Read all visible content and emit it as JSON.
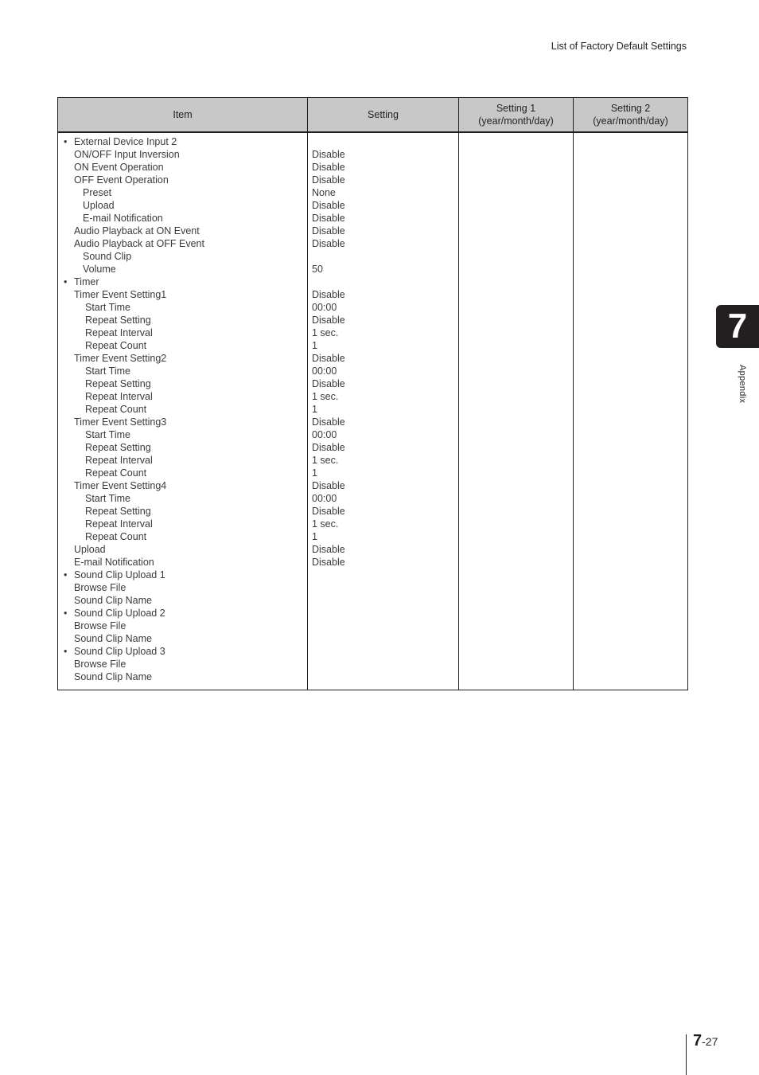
{
  "header": {
    "running_title": "List of Factory Default Settings"
  },
  "table": {
    "columns": [
      "Item",
      "Setting",
      "Setting 1\n(year/month/day)",
      "Setting 2\n(year/month/day)"
    ],
    "column_lines": {
      "item": "Item",
      "setting": "Setting",
      "setting1": [
        "Setting 1",
        "(year/month/day)"
      ],
      "setting2": [
        "Setting 2",
        "(year/month/day)"
      ]
    },
    "rows": [
      {
        "item": "External Device Input 2",
        "level": 0,
        "bullet": true,
        "value": ""
      },
      {
        "item": "ON/OFF Input Inversion",
        "level": 0,
        "bullet": false,
        "value": "Disable"
      },
      {
        "item": "ON Event Operation",
        "level": 0,
        "bullet": false,
        "value": "Disable"
      },
      {
        "item": "OFF Event Operation",
        "level": 0,
        "bullet": false,
        "value": "Disable"
      },
      {
        "item": "Preset",
        "level": 1,
        "bullet": false,
        "value": "None"
      },
      {
        "item": "Upload",
        "level": 1,
        "bullet": false,
        "value": "Disable"
      },
      {
        "item": "E-mail Notification",
        "level": 1,
        "bullet": false,
        "value": "Disable"
      },
      {
        "item": "Audio Playback at ON Event",
        "level": 0,
        "bullet": false,
        "value": "Disable"
      },
      {
        "item": "Audio Playback at OFF Event",
        "level": 0,
        "bullet": false,
        "value": "Disable"
      },
      {
        "item": "Sound Clip",
        "level": 1,
        "bullet": false,
        "value": ""
      },
      {
        "item": "Volume",
        "level": 1,
        "bullet": false,
        "value": "50"
      },
      {
        "item": "Timer",
        "level": 0,
        "bullet": true,
        "value": ""
      },
      {
        "item": "Timer Event Setting1",
        "level": 0,
        "bullet": false,
        "value": "Disable"
      },
      {
        "item": "Start Time",
        "level": 2,
        "bullet": false,
        "value": "00:00"
      },
      {
        "item": "Repeat Setting",
        "level": 2,
        "bullet": false,
        "value": "Disable"
      },
      {
        "item": "Repeat Interval",
        "level": 2,
        "bullet": false,
        "value": "1 sec."
      },
      {
        "item": "Repeat Count",
        "level": 2,
        "bullet": false,
        "value": "1"
      },
      {
        "item": "Timer Event Setting2",
        "level": 0,
        "bullet": false,
        "value": "Disable"
      },
      {
        "item": "Start Time",
        "level": 2,
        "bullet": false,
        "value": "00:00"
      },
      {
        "item": "Repeat Setting",
        "level": 2,
        "bullet": false,
        "value": "Disable"
      },
      {
        "item": "Repeat Interval",
        "level": 2,
        "bullet": false,
        "value": "1 sec."
      },
      {
        "item": "Repeat Count",
        "level": 2,
        "bullet": false,
        "value": "1"
      },
      {
        "item": "Timer Event Setting3",
        "level": 0,
        "bullet": false,
        "value": "Disable"
      },
      {
        "item": "Start Time",
        "level": 2,
        "bullet": false,
        "value": "00:00"
      },
      {
        "item": "Repeat Setting",
        "level": 2,
        "bullet": false,
        "value": "Disable"
      },
      {
        "item": "Repeat Interval",
        "level": 2,
        "bullet": false,
        "value": "1 sec."
      },
      {
        "item": "Repeat Count",
        "level": 2,
        "bullet": false,
        "value": "1"
      },
      {
        "item": "Timer Event Setting4",
        "level": 0,
        "bullet": false,
        "value": "Disable"
      },
      {
        "item": "Start Time",
        "level": 2,
        "bullet": false,
        "value": "00:00"
      },
      {
        "item": "Repeat Setting",
        "level": 2,
        "bullet": false,
        "value": "Disable"
      },
      {
        "item": "Repeat Interval",
        "level": 2,
        "bullet": false,
        "value": "1 sec."
      },
      {
        "item": "Repeat Count",
        "level": 2,
        "bullet": false,
        "value": "1"
      },
      {
        "item": "Upload",
        "level": 0,
        "bullet": false,
        "value": "Disable"
      },
      {
        "item": "E-mail Notification",
        "level": 0,
        "bullet": false,
        "value": "Disable"
      },
      {
        "item": "Sound Clip Upload 1",
        "level": 0,
        "bullet": true,
        "value": ""
      },
      {
        "item": "Browse File",
        "level": 0,
        "bullet": false,
        "value": ""
      },
      {
        "item": "Sound Clip Name",
        "level": 0,
        "bullet": false,
        "value": ""
      },
      {
        "item": "Sound Clip Upload 2",
        "level": 0,
        "bullet": true,
        "value": ""
      },
      {
        "item": "Browse File",
        "level": 0,
        "bullet": false,
        "value": ""
      },
      {
        "item": "Sound Clip Name",
        "level": 0,
        "bullet": false,
        "value": ""
      },
      {
        "item": "Sound Clip Upload 3",
        "level": 0,
        "bullet": true,
        "value": ""
      },
      {
        "item": "Browse File",
        "level": 0,
        "bullet": false,
        "value": ""
      },
      {
        "item": "Sound Clip Name",
        "level": 0,
        "bullet": false,
        "value": ""
      }
    ],
    "bullet_glyph": "•"
  },
  "chapter_tab": {
    "number": "7",
    "label": "Appendix"
  },
  "footer": {
    "chapter": "7",
    "page": "-27"
  },
  "colors": {
    "header_bg": "#c8c8c8",
    "tab_bg": "#231f20",
    "text": "#231f20"
  }
}
